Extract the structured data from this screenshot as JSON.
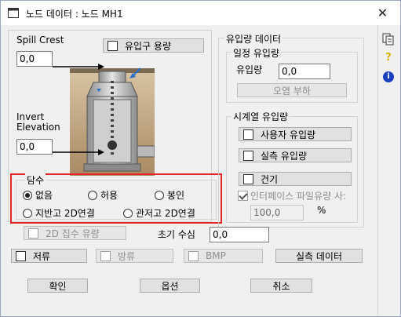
{
  "window": {
    "title": "노드 데이터 : 노드 MH1",
    "close": "✕"
  },
  "left": {
    "spill_crest_label": "Spill Crest",
    "spill_crest_value": "0,0",
    "inflow_capacity_label": "유입구 용량",
    "invert_label_line1": "Invert",
    "invert_label_line2": "Elevation",
    "invert_value": "0,0"
  },
  "ponding": {
    "title": "담수",
    "options": [
      "없음",
      "허용",
      "봉인",
      "지반고 2D연결",
      "관저고 2D연결"
    ],
    "selected": "없음"
  },
  "inflow_data": {
    "title": "유입량 데이터",
    "constant_group_title": "일정 유입량",
    "inflow_label": "유입량",
    "inflow_value": "0,0",
    "pollutant_load_button": "오염 부하"
  },
  "timeseries": {
    "title": "시계열 유입량",
    "user_inflow_button": "사용자 유입량",
    "measured_inflow_button": "실측 유입량",
    "dry_weather_button": "건기",
    "interface_file_label": "인터페이스 파일유량 사:",
    "interface_file_checked": true,
    "percent_value": "100,0",
    "percent_unit": "%"
  },
  "bottom": {
    "flow_2d_label": "2D 집수 유량",
    "initial_depth_label": "초기 수심",
    "initial_depth_value": "0,0",
    "storage_label": "저류",
    "outfall_label": "방류",
    "bmp_label": "BMP",
    "measured_data_button": "실측 데이터",
    "ok_button": "확인",
    "options_button": "옵션",
    "cancel_button": "취소"
  },
  "sidebar": {
    "copy_icon": "copy-icon",
    "help_icon_glyph": "?",
    "info_icon_glyph": "i"
  },
  "colors": {
    "highlight_border": "#e4262b",
    "window_bg": "#f0f0f0"
  }
}
